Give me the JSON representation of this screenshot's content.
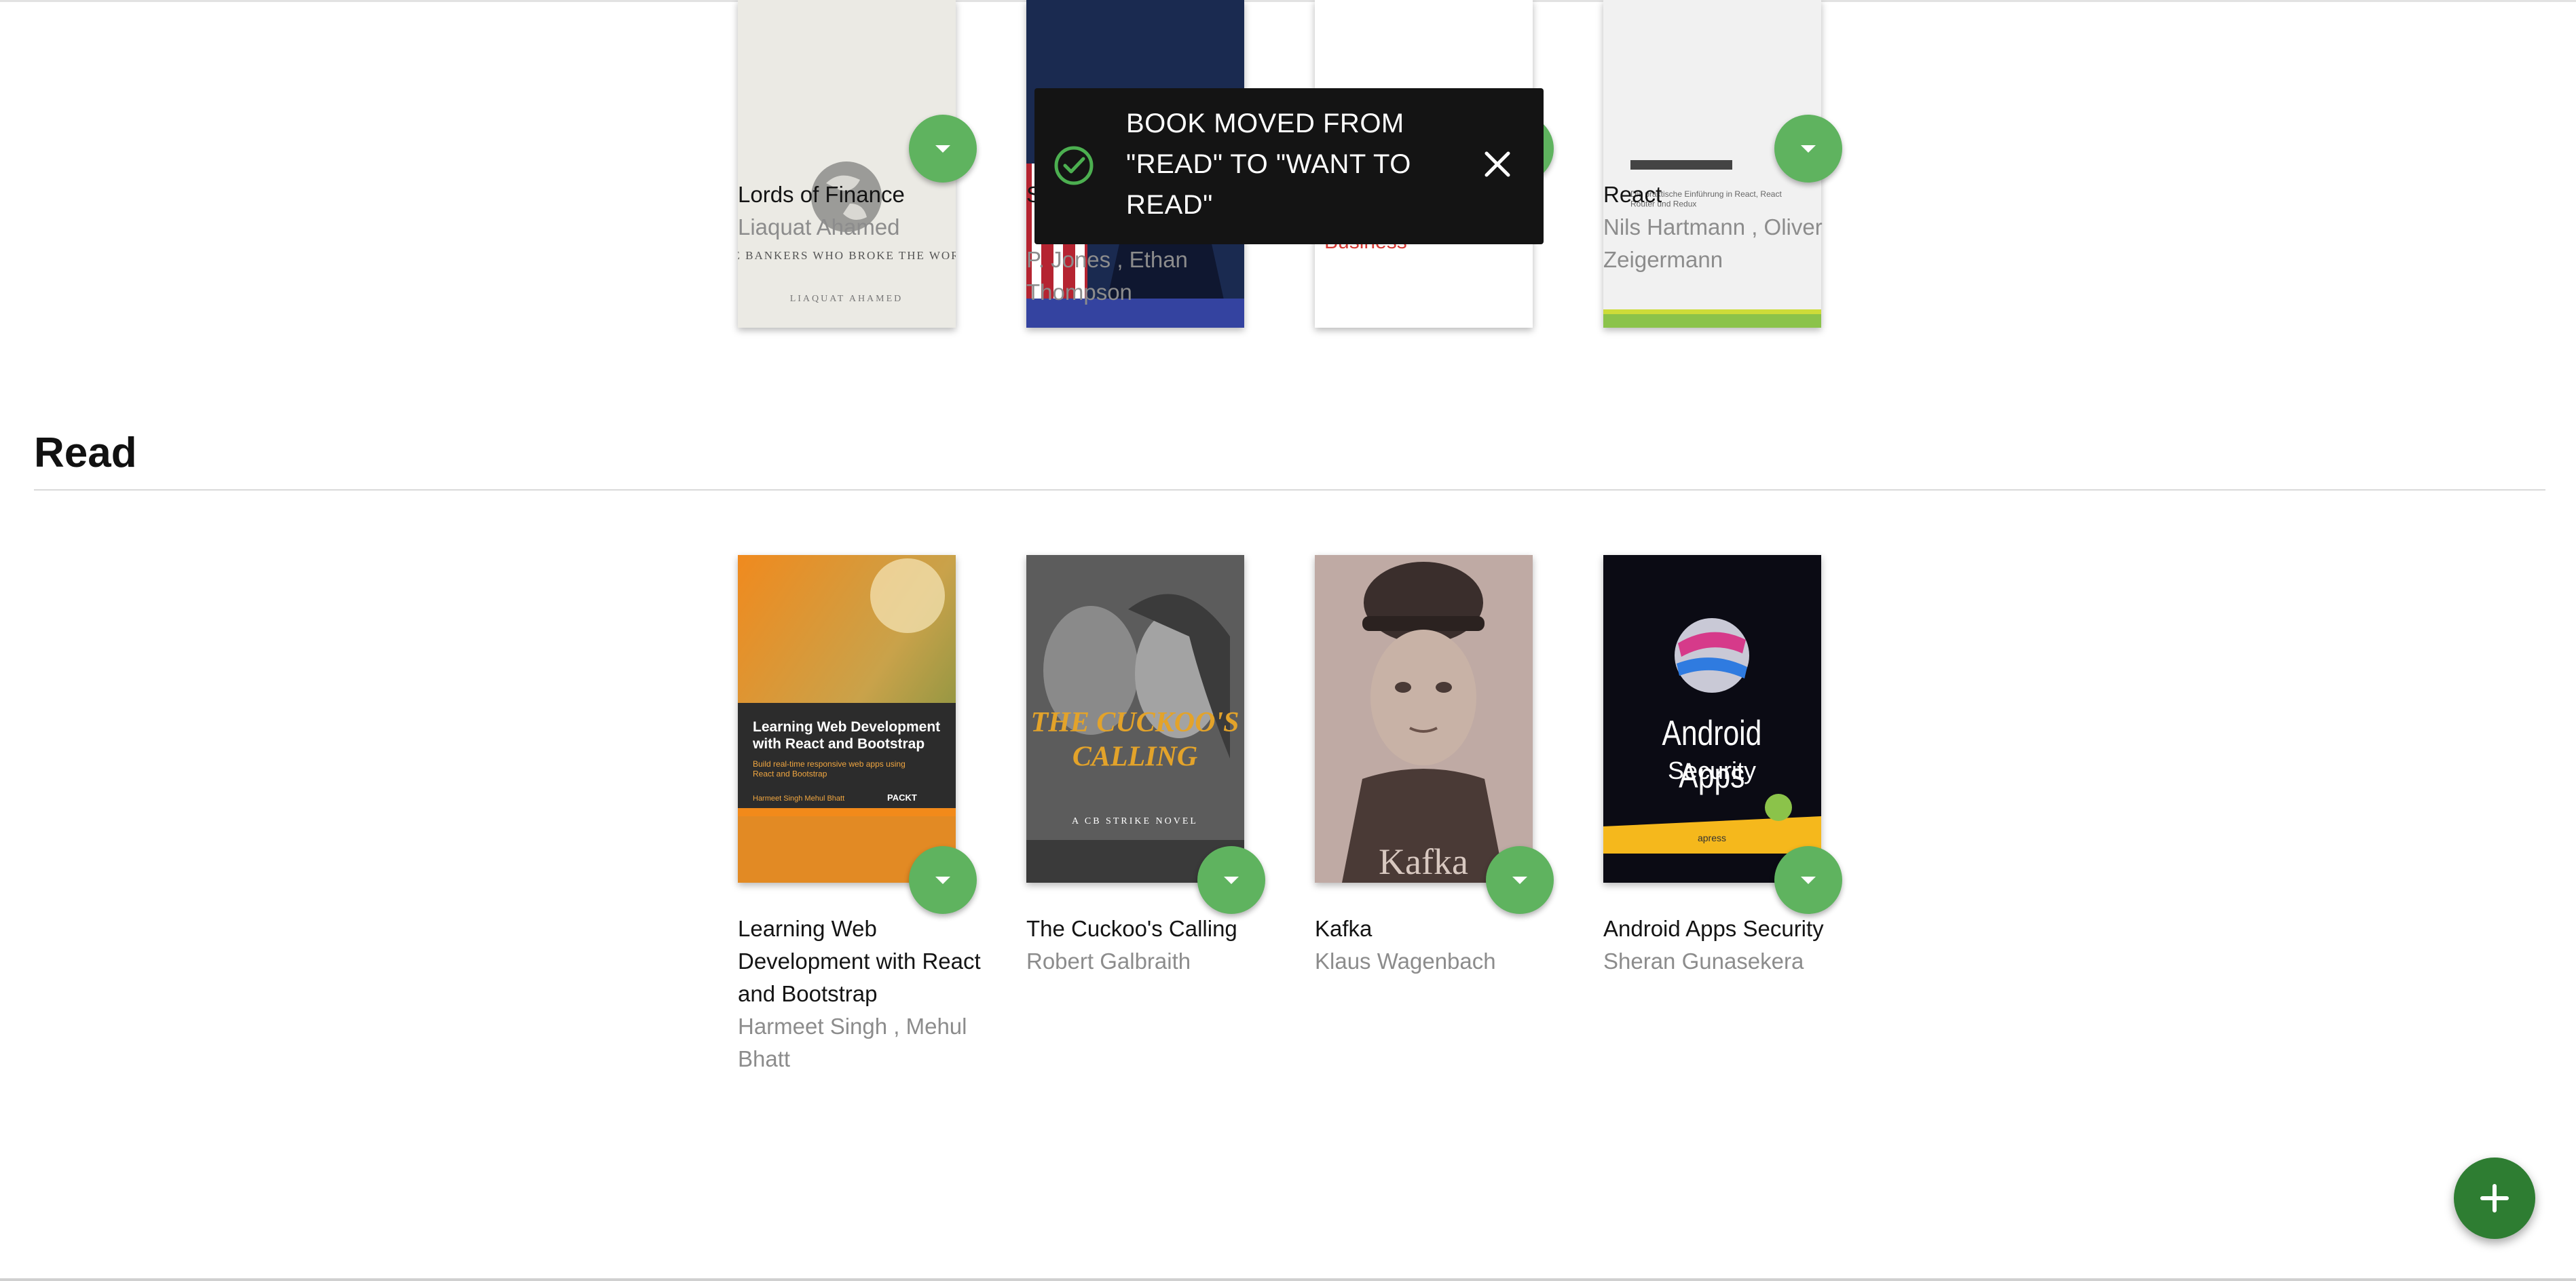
{
  "toast": {
    "message": "BOOK MOVED FROM \"READ\" TO \"WANT TO READ\"",
    "icon": "check-circle-icon",
    "close_icon": "close-icon",
    "accent": "#4caf50"
  },
  "shelf_top": {
    "books": [
      {
        "title": "Lords of Finance",
        "authors": "Liaquat Ahamed"
      },
      {
        "title": "S",
        "authors": "P. Jones , Ethan Thompson"
      },
      {
        "title": "",
        "authors": ""
      },
      {
        "title": "React",
        "authors": "Nils Hartmann , Oliver Zeigermann"
      }
    ]
  },
  "shelf_read": {
    "title": "Read",
    "books": [
      {
        "title": "Learning Web Development with React and Bootstrap",
        "authors": "Harmeet Singh , Mehul Bhatt"
      },
      {
        "title": "The Cuckoo's Calling",
        "authors": "Robert Galbraith"
      },
      {
        "title": "Kafka",
        "authors": "Klaus Wagenbach"
      },
      {
        "title": "Android Apps Security",
        "authors": "Sheran Gunasekera"
      }
    ]
  },
  "cover_text": {
    "lords": "THE BANKERS WHO BROKE THE WORLD",
    "lords_author": "LIAQUAT AHAMED",
    "energize": "Energize Your Business",
    "react_sub": "Die praktische Einführung in React, React Router und Redux",
    "lwd_title": "Learning Web Development with React and Bootstrap",
    "lwd_sub": "Build real-time responsive web apps using React and Bootstrap",
    "lwd_authors": "Harmeet Singh  Mehul Bhatt",
    "lwd_pub": "PACKT",
    "cuckoo_title": "THE CUCKOO'S CALLING",
    "cuckoo_sub": "A CB STRIKE NOVEL",
    "kafka": "Kafka",
    "android_title": "Android Apps",
    "android_title2": "Security",
    "android_pub": "apress"
  },
  "fab": {
    "icon": "plus-icon"
  },
  "colors": {
    "shelf_button": "#5fb35f",
    "fab": "#2e7d32",
    "toast_bg": "#141414"
  }
}
